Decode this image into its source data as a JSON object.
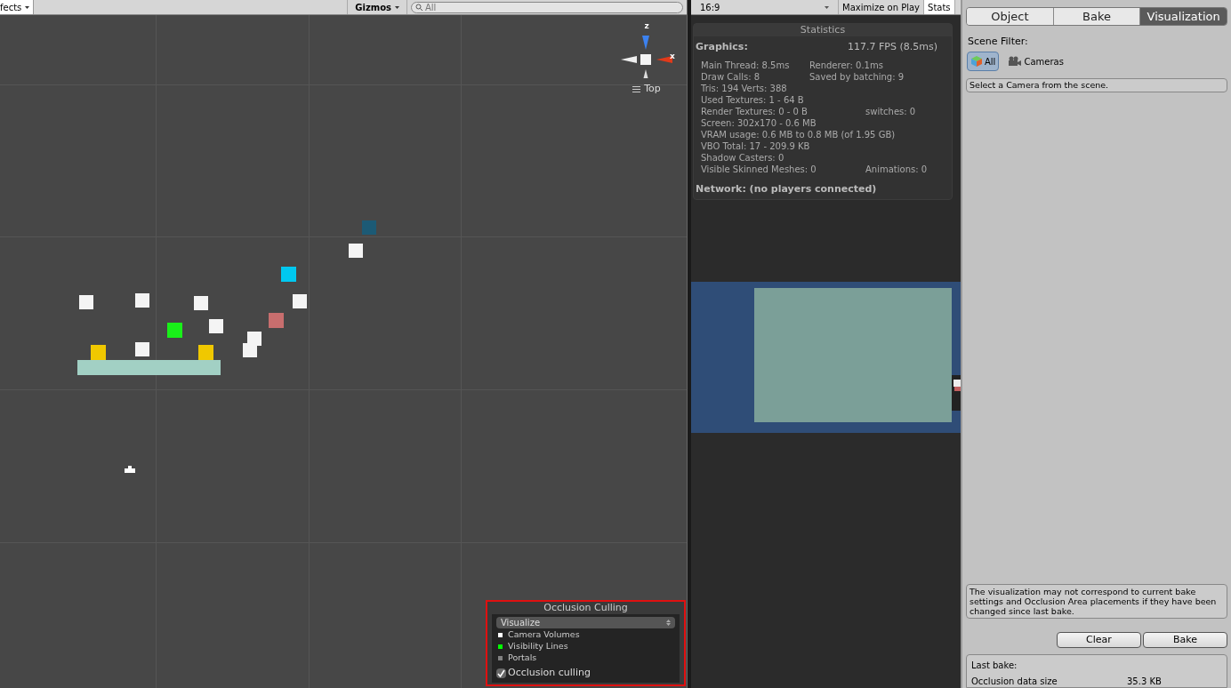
{
  "scene_toolbar": {
    "effects_label": "fects",
    "gizmos_label": "Gizmos",
    "search": {
      "value": "All"
    }
  },
  "gizmo": {
    "z_label": "z",
    "x_label": "x",
    "view_label": "Top"
  },
  "occlusion_panel": {
    "title": "Occlusion Culling",
    "mode": "Visualize",
    "legend": [
      {
        "label": "Camera Volumes",
        "color": "#ffffff"
      },
      {
        "label": "Visibility Lines",
        "color": "#00ff00"
      },
      {
        "label": "Portals",
        "color": "#808080"
      }
    ],
    "culling": {
      "label": "Occlusion culling",
      "checked": true
    }
  },
  "game_toolbar": {
    "aspect": "16:9",
    "toggles": [
      {
        "label": "Maximize on Play",
        "selected": false
      },
      {
        "label": "Stats",
        "selected": true
      }
    ]
  },
  "statistics": {
    "title": "Statistics",
    "graphics_label": "Graphics:",
    "fps": "117.7 FPS (8.5ms)",
    "rows": [
      {
        "left": "Main Thread: 8.5ms",
        "right": "Renderer: 0.1ms"
      },
      {
        "left": "Draw Calls: 8",
        "right": "Saved by batching: 9"
      },
      {
        "left": "Tris: 194 Verts: 388"
      },
      {
        "left": "Used Textures: 1 - 64 B"
      },
      {
        "left": "Render Textures: 0 - 0 B",
        "right": "switches: 0"
      },
      {
        "left": "Screen: 302x170 - 0.6 MB"
      },
      {
        "left": "VRAM usage: 0.6 MB to 0.8 MB (of 1.95 GB)"
      },
      {
        "left": "VBO Total: 17 - 209.9 KB"
      },
      {
        "left": "Shadow Casters: 0"
      },
      {
        "left": "Visible Skinned Meshes: 0",
        "right": "Animations: 0"
      }
    ],
    "network": "Network: (no players connected)"
  },
  "inspector": {
    "tabs": [
      {
        "label": "Object",
        "selected": false
      },
      {
        "label": "Bake",
        "selected": false
      },
      {
        "label": "Visualization",
        "selected": true
      }
    ],
    "scene_filter_label": "Scene Filter:",
    "filters": [
      {
        "label": "All",
        "kind": "all",
        "selected": true
      },
      {
        "label": "Cameras",
        "kind": "cameras",
        "selected": false
      }
    ],
    "camera_hint": "Select a Camera from the scene.",
    "warning": "The visualization may not correspond to current bake settings and Occlusion Area placements if they have been changed since last bake.",
    "buttons": [
      "Clear",
      "Bake"
    ],
    "last_bake": {
      "title": "Last bake:",
      "label": "Occlusion data size",
      "value": "35.3 KB"
    }
  }
}
